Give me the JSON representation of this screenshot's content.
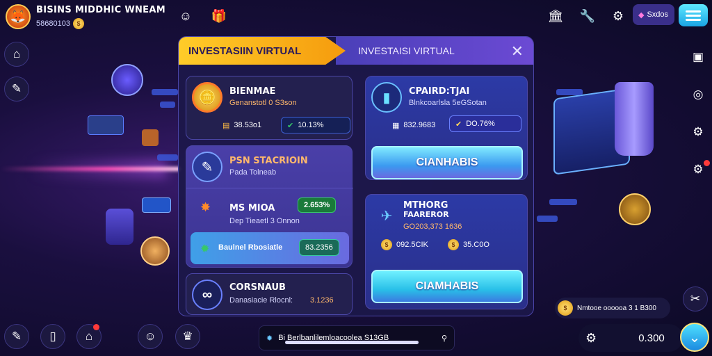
{
  "app": {
    "title": "BISINS MIDDHIC WNEAM",
    "currency": "58680103",
    "coin_glyph": "$"
  },
  "status": {
    "label": "Sxdos"
  },
  "tabs": [
    {
      "label": "INVESTASIIN VIRTUAL"
    },
    {
      "label": "INVESTAISI VIRTUAL"
    }
  ],
  "cards": {
    "left1": {
      "name": "BIENMAE",
      "sub": "Genanstotl 0 S3son",
      "stat1": "38.53o1",
      "stat2": "10.13%"
    },
    "left2": {
      "name": "PSN STACRIOIN",
      "sub": "Pada Tolneab"
    },
    "left3": {
      "name": "MS MIOA",
      "sub": "Dep Tieaetl 3 Onnon",
      "badge": "2.653%"
    },
    "left4": {
      "name": "Baulnel Rbosiatle",
      "badge": "83.2356"
    },
    "left5": {
      "name": "CORSNAUB",
      "sub": "Danasiacie Rlocnl:",
      "sub2": "3.1236"
    },
    "right1": {
      "name": "CPAIRD:TJAI",
      "sub": "Blnkcoarlsla 5eGSotan",
      "stat1": "832.9683",
      "stat2": "DO.76%"
    },
    "right2": {
      "name": "MTHORG",
      "name2": "FAAREROR",
      "sub": "GO203,373 1636",
      "stat1": "092.5CIK",
      "stat2": "35.C0O"
    }
  },
  "buttons": {
    "cta1": "CIANHABIS",
    "cta2": "CIAMHABIS"
  },
  "bottom": {
    "bar_text": "Bi Berlbanlilemloacoolea S13GB",
    "progress": 0.95,
    "right_value": "0.300",
    "notif": "Nmtooe oooooa 3 1 B300"
  },
  "icons": [
    "logo-icon",
    "emoji-icon",
    "gift-icon",
    "bank-icon",
    "tools-icon",
    "settings-icon",
    "home-icon",
    "chat-icon",
    "share-icon",
    "gear-icon",
    "close-icon",
    "search-icon"
  ],
  "colors": {
    "accent": "#ffcc29",
    "cta": "#4fd6ff",
    "panel": "#1c184a",
    "positive": "#37c868"
  }
}
